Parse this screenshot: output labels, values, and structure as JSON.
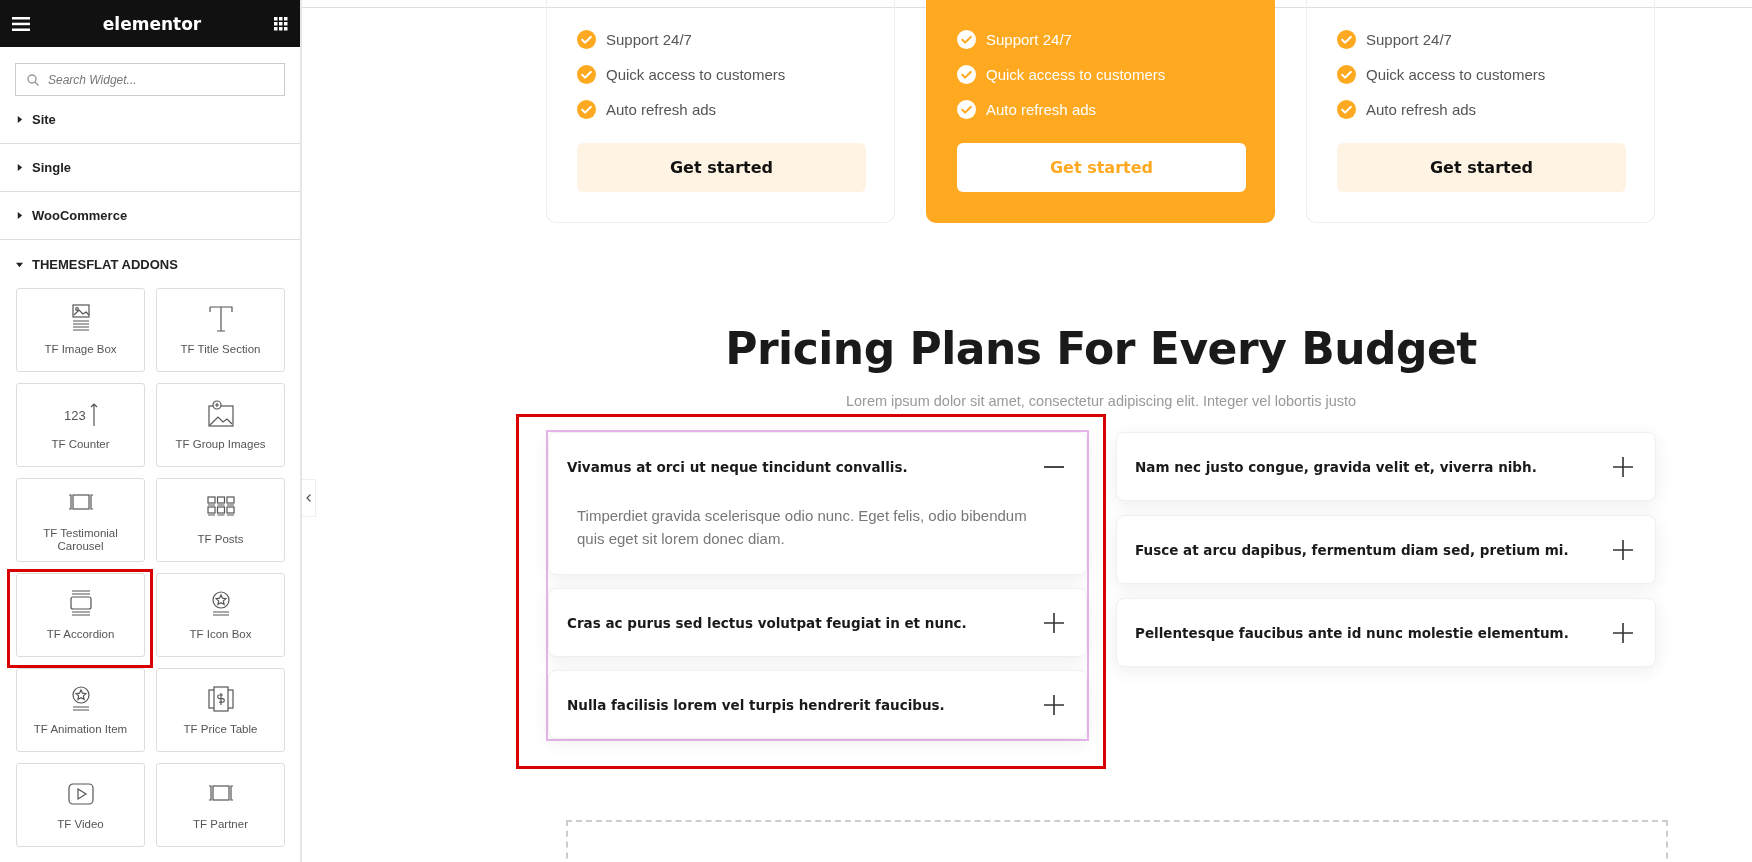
{
  "sidebar": {
    "header": {
      "title": "elementor"
    },
    "search": {
      "placeholder": "Search Widget..."
    },
    "categories": [
      {
        "label": "Site",
        "expanded": false
      },
      {
        "label": "Single",
        "expanded": false
      },
      {
        "label": "WooCommerce",
        "expanded": false
      },
      {
        "label": "THEMESFLAT ADDONS",
        "expanded": true
      }
    ],
    "widgets": [
      {
        "label": "TF Image Box",
        "kind": "image-box",
        "highlighted": false
      },
      {
        "label": "TF Title Section",
        "kind": "title",
        "highlighted": false
      },
      {
        "label": "TF Counter",
        "kind": "counter",
        "icon_label": "123",
        "highlighted": false
      },
      {
        "label": "TF Group Images",
        "kind": "group-images",
        "highlighted": false
      },
      {
        "label": "TF Testimonial Carousel",
        "kind": "carousel",
        "highlighted": false
      },
      {
        "label": "TF Posts",
        "kind": "posts",
        "highlighted": false
      },
      {
        "label": "TF Accordion",
        "kind": "accordion",
        "highlighted": true
      },
      {
        "label": "TF Icon Box",
        "kind": "icon-box",
        "highlighted": false
      },
      {
        "label": "TF Animation Item",
        "kind": "icon-box",
        "highlighted": false
      },
      {
        "label": "TF Price Table",
        "kind": "price-table",
        "highlighted": false
      },
      {
        "label": "TF Video",
        "kind": "video",
        "highlighted": false
      },
      {
        "label": "TF Partner",
        "kind": "carousel",
        "highlighted": false
      }
    ]
  },
  "pricing_cards": [
    {
      "featured": false,
      "features": [
        "Support 24/7",
        "Quick access to customers",
        "Auto refresh ads"
      ],
      "button": "Get started"
    },
    {
      "featured": true,
      "features": [
        "Support 24/7",
        "Quick access to customers",
        "Auto refresh ads"
      ],
      "button": "Get started"
    },
    {
      "featured": false,
      "features": [
        "Support 24/7",
        "Quick access to customers",
        "Auto refresh ads"
      ],
      "button": "Get started"
    }
  ],
  "section": {
    "title": "Pricing Plans For Every Budget",
    "subtitle": "Lorem ipsum dolor sit amet, consectetur adipiscing elit. Integer vel lobortis justo",
    "selected": true,
    "accordion_left": [
      {
        "title": "Vivamus at orci ut neque tincidunt convallis.",
        "expanded": true,
        "body": "Timperdiet gravida scelerisque odio nunc. Eget felis, odio bibendum quis eget sit lorem donec diam."
      },
      {
        "title": "Cras ac purus sed lectus volutpat feugiat in et nunc.",
        "expanded": false
      },
      {
        "title": "Nulla facilisis lorem vel turpis hendrerit faucibus.",
        "expanded": false
      }
    ],
    "accordion_right": [
      {
        "title": "Nam nec justo congue, gravida velit et, viverra nibh.",
        "expanded": false
      },
      {
        "title": "Fusce at arcu dapibus, fermentum diam sed, pretium mi.",
        "expanded": false
      },
      {
        "title": "Pellentesque faucibus ante id nunc molestie elementum.",
        "expanded": false
      }
    ]
  }
}
